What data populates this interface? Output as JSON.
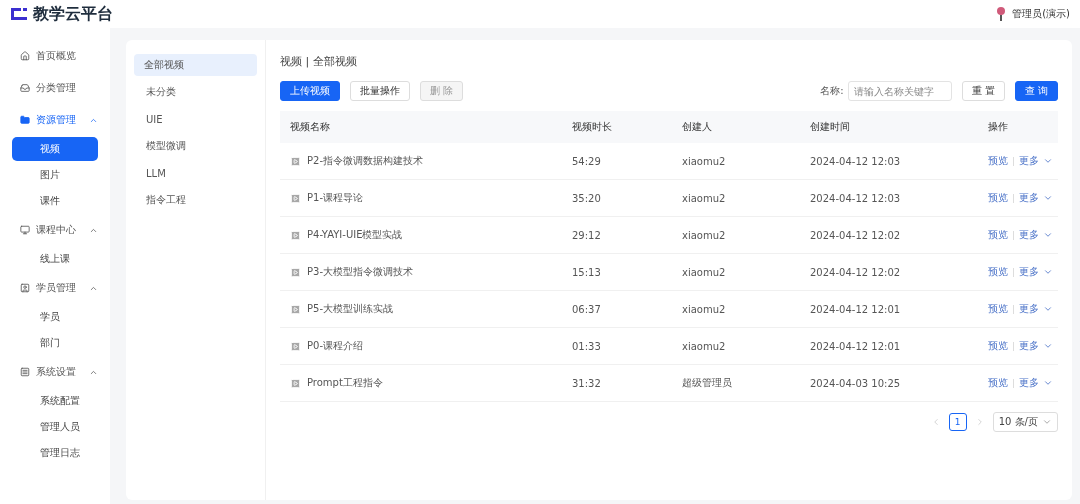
{
  "header": {
    "app_title": "教学云平台",
    "user_name": "管理员(演示)"
  },
  "sidebar": {
    "groups": [
      {
        "label": "首页概览",
        "selected": false
      },
      {
        "label": "分类管理",
        "selected": false
      },
      {
        "label": "资源管理",
        "selected": true,
        "expanded": true,
        "children": [
          {
            "label": "视频",
            "selected": true
          },
          {
            "label": "图片",
            "selected": false
          },
          {
            "label": "课件",
            "selected": false
          }
        ]
      },
      {
        "label": "课程中心",
        "selected": false,
        "expanded": true,
        "children": [
          {
            "label": "线上课",
            "selected": false
          }
        ]
      },
      {
        "label": "学员管理",
        "selected": false,
        "expanded": true,
        "children": [
          {
            "label": "学员",
            "selected": false
          },
          {
            "label": "部门",
            "selected": false
          }
        ]
      },
      {
        "label": "系统设置",
        "selected": false,
        "expanded": true,
        "children": [
          {
            "label": "系统配置",
            "selected": false
          },
          {
            "label": "管理人员",
            "selected": false
          },
          {
            "label": "管理日志",
            "selected": false
          }
        ]
      }
    ]
  },
  "categories": [
    {
      "label": "全部视频",
      "selected": true
    },
    {
      "label": "未分类",
      "selected": false
    },
    {
      "label": "UIE",
      "selected": false
    },
    {
      "label": "模型微调",
      "selected": false
    },
    {
      "label": "LLM",
      "selected": false
    },
    {
      "label": "指令工程",
      "selected": false
    }
  ],
  "breadcrumb": "视频 | 全部视频",
  "toolbar": {
    "buttons": [
      {
        "label": "上传视频",
        "kind": "primary",
        "disabled": false
      },
      {
        "label": "批量操作",
        "kind": "default",
        "disabled": false
      },
      {
        "label": "删 除",
        "kind": "default",
        "disabled": true
      }
    ],
    "search_label": "名称:",
    "search": {
      "placeholder": "请输入名称关键字"
    },
    "reset": "重 置",
    "query": "查 询"
  },
  "table": {
    "columns": [
      "视频名称",
      "视频时长",
      "创建人",
      "创建时间",
      "操作"
    ],
    "rows": [
      {
        "name": "P2-指令微调数据构建技术",
        "duration": "54:29",
        "creator": "xiaomu2",
        "created": "2024-04-12 12:03",
        "preview": "预览",
        "more": "更多"
      },
      {
        "name": "P1-课程导论",
        "duration": "35:20",
        "creator": "xiaomu2",
        "created": "2024-04-12 12:03",
        "preview": "预览",
        "more": "更多"
      },
      {
        "name": "P4-YAYI-UIE模型实战",
        "duration": "29:12",
        "creator": "xiaomu2",
        "created": "2024-04-12 12:02",
        "preview": "预览",
        "more": "更多"
      },
      {
        "name": "P3-大模型指令微调技术",
        "duration": "15:13",
        "creator": "xiaomu2",
        "created": "2024-04-12 12:02",
        "preview": "预览",
        "more": "更多"
      },
      {
        "name": "P5-大模型训练实战",
        "duration": "06:37",
        "creator": "xiaomu2",
        "created": "2024-04-12 12:01",
        "preview": "预览",
        "more": "更多"
      },
      {
        "name": "P0-课程介绍",
        "duration": "01:33",
        "creator": "xiaomu2",
        "created": "2024-04-12 12:01",
        "preview": "预览",
        "more": "更多"
      },
      {
        "name": "Prompt工程指令",
        "duration": "31:32",
        "creator": "超级管理员",
        "created": "2024-04-03 10:25",
        "preview": "预览",
        "more": "更多"
      }
    ]
  },
  "pagination": {
    "pages": [
      {
        "label": "1",
        "selected": true
      }
    ],
    "page_size": "10 条/页"
  }
}
